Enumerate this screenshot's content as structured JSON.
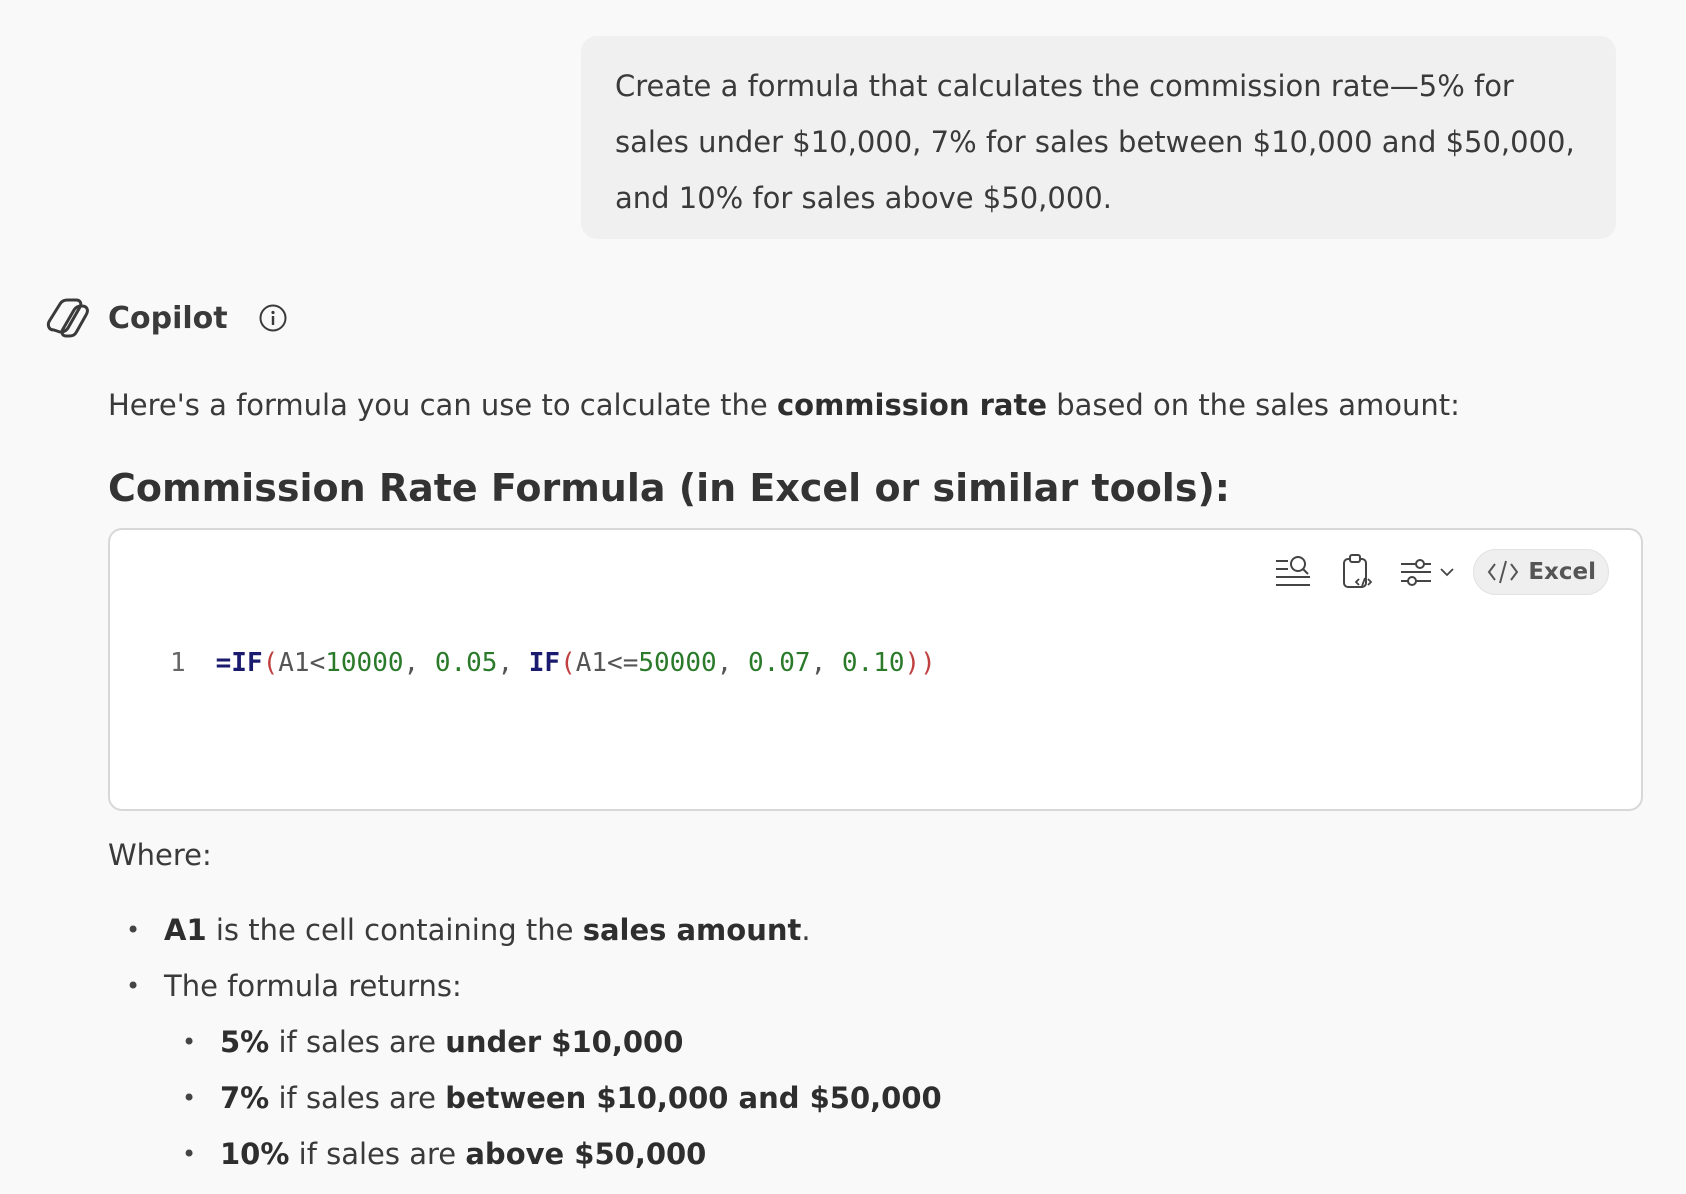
{
  "user_message": {
    "text": "Create a formula that calculates the commission rate—5% for sales under $10,000, 7% for sales between $10,000 and $50,000, and 10% for sales above $50,000."
  },
  "assistant": {
    "name": "Copilot",
    "logo_icon": "copilot-logo-icon",
    "info_icon": "info-icon"
  },
  "response": {
    "intro_before": "Here's a formula you can use to calculate the ",
    "intro_bold": "commission rate",
    "intro_after": " based on the sales amount:",
    "heading": "Commission Rate Formula (in Excel or similar tools):",
    "code": {
      "language_label": "Excel",
      "toolbar_icons": [
        "explain-code-icon",
        "copy-code-icon",
        "settings-sliders-icon",
        "chevron-down-icon",
        "code-brackets-icon"
      ],
      "line_number": "1",
      "tokens": {
        "t1": "=IF",
        "t2": "(",
        "t3": "A1<",
        "t4": "10000",
        "t5": ", ",
        "t6": "0.05",
        "t7": ", ",
        "t8": "IF",
        "t9": "(",
        "t10": "A1<=",
        "t11": "50000",
        "t12": ", ",
        "t13": "0.07",
        "t14": ", ",
        "t15": "0.10",
        "t16": "))"
      }
    },
    "where_label": "Where:",
    "bullet_1": {
      "bold": "A1",
      "mid": " is the cell containing the ",
      "bold2": "sales amount",
      "end": "."
    },
    "bullet_2": {
      "text": "The formula returns:"
    },
    "sub_bullets": [
      {
        "bold": "5%",
        "mid": " if sales are ",
        "bold2": "under $10,000"
      },
      {
        "bold": "7%",
        "mid": " if sales are ",
        "bold2": "between $10,000 and $50,000"
      },
      {
        "bold": "10%",
        "mid": " if sales are ",
        "bold2": "above $50,000"
      }
    ]
  },
  "colors": {
    "background": "#f9f9f9",
    "user_bubble": "#f0f0f0",
    "code_bg": "#ffffff",
    "keyword": "#1a1a6e",
    "number": "#2a7a2a",
    "paren": "#c04040"
  }
}
